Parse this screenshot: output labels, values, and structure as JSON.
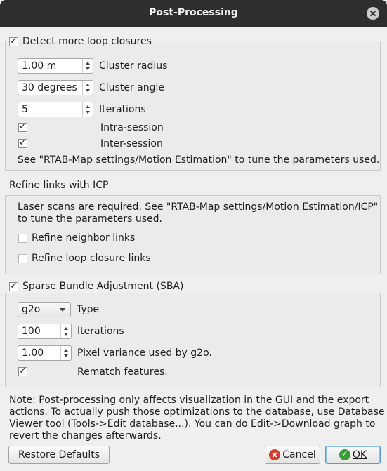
{
  "window": {
    "title": "Post-Processing"
  },
  "loop": {
    "title": "Detect more loop closures",
    "checked": true,
    "cluster_radius": {
      "value": "1.00 m",
      "label": "Cluster radius"
    },
    "cluster_angle": {
      "value": "30 degrees",
      "label": "Cluster angle"
    },
    "iterations": {
      "value": "5",
      "label": "Iterations"
    },
    "intra_session": {
      "label": "Intra-session",
      "checked": true
    },
    "inter_session": {
      "label": "Inter-session",
      "checked": true
    },
    "note": "See \"RTAB-Map settings/Motion Estimation\" to tune the parameters used."
  },
  "icp": {
    "title": "Refine links with ICP",
    "note_line1": "Laser scans are required. See \"RTAB-Map settings/Motion Estimation/ICP\"",
    "note_line2": "to tune the parameters used.",
    "refine_neighbor": {
      "label": "Refine neighbor links",
      "checked": false
    },
    "refine_loop": {
      "label": "Refine loop closure links",
      "checked": false
    }
  },
  "sba": {
    "title": "Sparse Bundle Adjustment (SBA)",
    "checked": true,
    "type": {
      "value": "g2o",
      "label": "Type"
    },
    "iterations": {
      "value": "100",
      "label": "Iterations"
    },
    "variance": {
      "value": "1.00",
      "label": "Pixel variance used by g2o."
    },
    "rematch": {
      "label": "Rematch features.",
      "checked": true
    }
  },
  "footer": {
    "note_lines": [
      "Note: Post-processing only affects visualization in the GUI and the export",
      "actions. To actually push those optimizations to the database, use Database",
      "Viewer tool (Tools->Edit database...). You can do Edit->Download graph to",
      "revert the changes afterwards."
    ],
    "restore_label": "Restore Defaults",
    "cancel_label": "Cancel",
    "ok_label": "OK"
  },
  "colors": {
    "titlebar": "#2e2e2e",
    "accent": "#5b9bd5",
    "cancel_icon": "#d63b2f",
    "ok_icon": "#3a9d3a"
  }
}
